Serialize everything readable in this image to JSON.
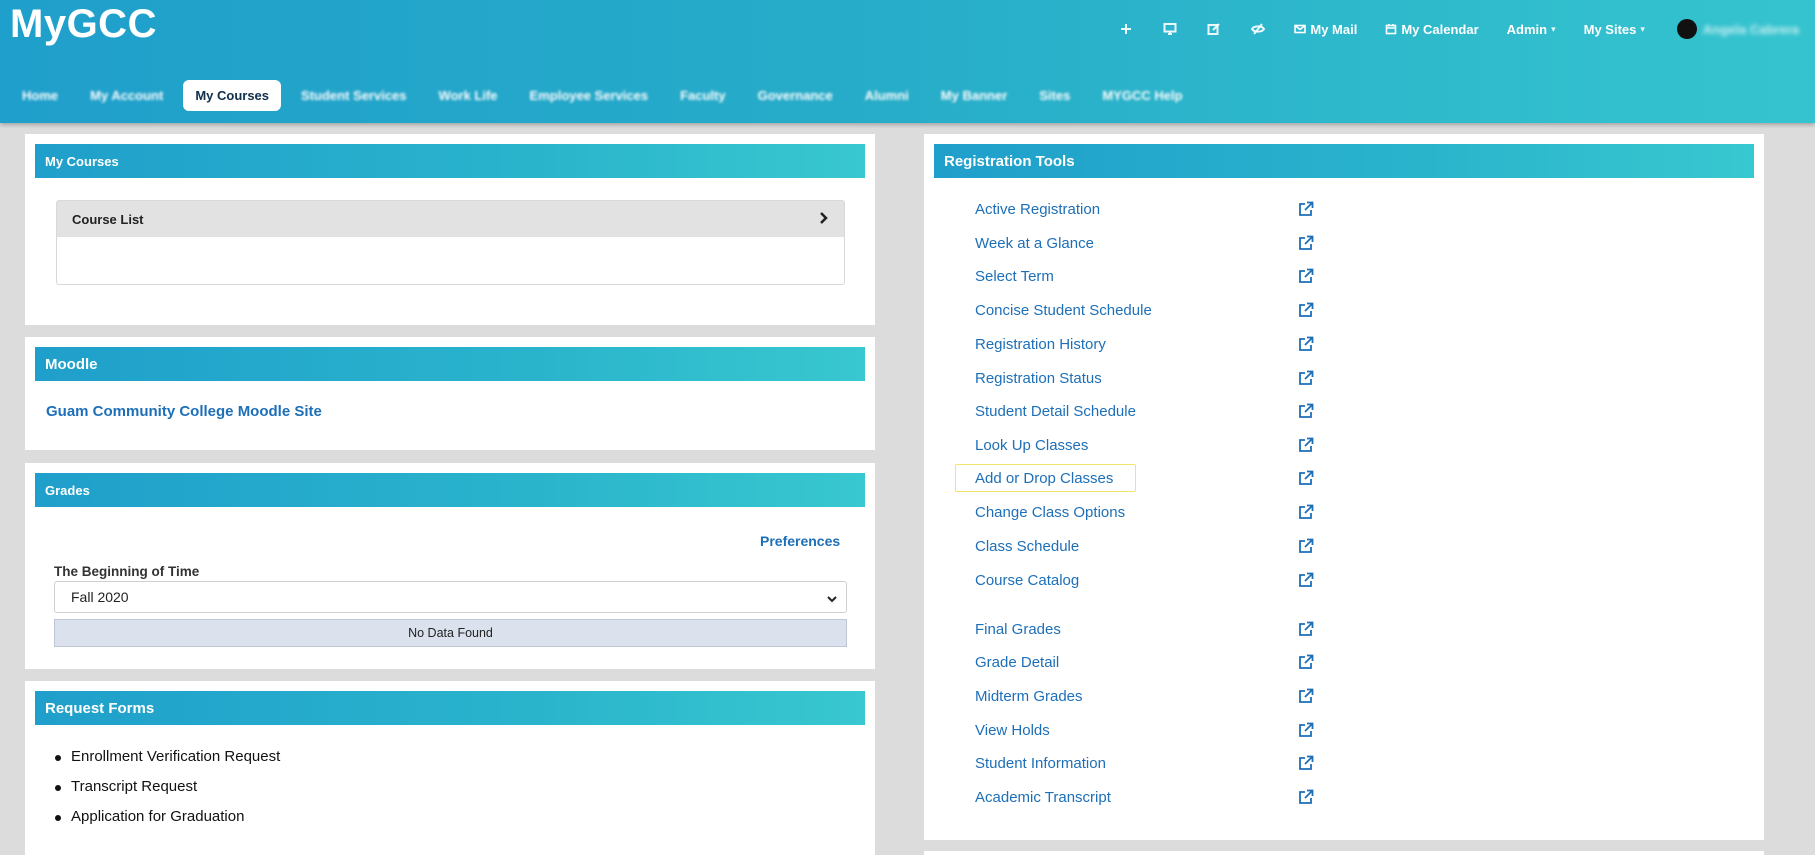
{
  "app": {
    "logo": "MyGCC"
  },
  "toolbar": {
    "icons": [
      "plus-icon",
      "desktop-icon",
      "edit-icon",
      "eye-slash-icon"
    ],
    "mail_label": "My Mail",
    "calendar_label": "My Calendar",
    "admin_label": "Admin",
    "sites_label": "My Sites",
    "user_name": "Angela Cabrera"
  },
  "nav": {
    "items": [
      "Home",
      "My Account",
      "My Courses",
      "Student Services",
      "Work Life",
      "Employee Services",
      "Faculty",
      "Governance",
      "Alumni",
      "My Banner",
      "Sites",
      "MYGCC Help"
    ],
    "active": "My Courses"
  },
  "my_courses": {
    "title": "My Courses",
    "course_list_label": "Course List"
  },
  "moodle": {
    "title": "Moodle",
    "link": "Guam Community College Moodle Site"
  },
  "grades": {
    "title": "Grades",
    "preferences_label": "Preferences",
    "term_label": "The Beginning of Time",
    "term_value": "Fall 2020",
    "empty_message": "No Data Found"
  },
  "request_forms": {
    "title": "Request Forms",
    "items": [
      "Enrollment Verification Request",
      "Transcript Request",
      "Application for Graduation"
    ]
  },
  "registration_tools": {
    "title": "Registration Tools",
    "items": [
      "Active Registration",
      "Week at a Glance",
      "Select Term",
      "Concise Student Schedule",
      "Registration History",
      "Registration Status",
      "Student Detail Schedule",
      "Look Up Classes",
      "Add or Drop Classes",
      "Change Class Options",
      "Class Schedule",
      "Course Catalog",
      "Final Grades",
      "Grade Detail",
      "Midterm Grades",
      "View Holds",
      "Student Information",
      "Academic Transcript"
    ],
    "highlighted": "Add or Drop Classes"
  },
  "colors": {
    "header_start": "#1f9fcb",
    "header_end": "#35c4cf",
    "link": "#1d6fb8",
    "highlight_border": "#f3e46a"
  }
}
